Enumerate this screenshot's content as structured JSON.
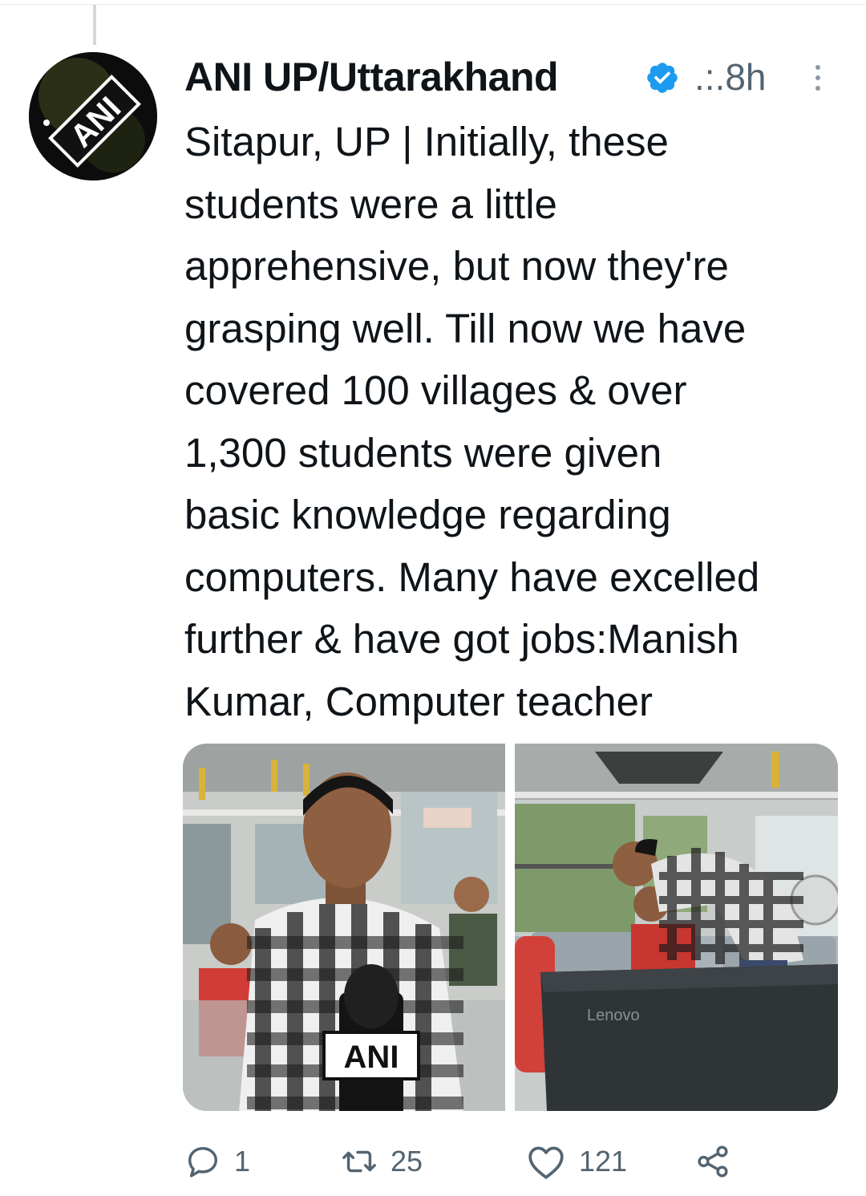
{
  "tweet": {
    "author_name": "ANI UP/Uttarakhand",
    "verified": true,
    "meta": ".:.8h",
    "avatar_text": "ANI",
    "text_lines": [
      "Sitapur, UP | Initially, these",
      "students were a little",
      "apprehensive, but now they're",
      "grasping well. Till now we have",
      "covered 100 villages & over",
      "1,300 students were given",
      "basic knowledge regarding",
      "computers. Many have excelled",
      "further & have got jobs:Manish",
      "Kumar, Computer teacher"
    ],
    "media": {
      "photo1_mic_label": "ANI",
      "photo2_laptop_label": "Lenovo"
    },
    "actions": {
      "reply_count": "1",
      "retweet_count": "25",
      "like_count": "121"
    }
  },
  "icons": {
    "verified": "verified-badge-icon",
    "more": "more-vertical-icon",
    "reply": "reply-icon",
    "retweet": "retweet-icon",
    "like": "heart-icon",
    "share": "share-icon"
  },
  "colors": {
    "verified_blue": "#1d9bf0",
    "text": "#0f1419",
    "secondary": "#536471"
  }
}
